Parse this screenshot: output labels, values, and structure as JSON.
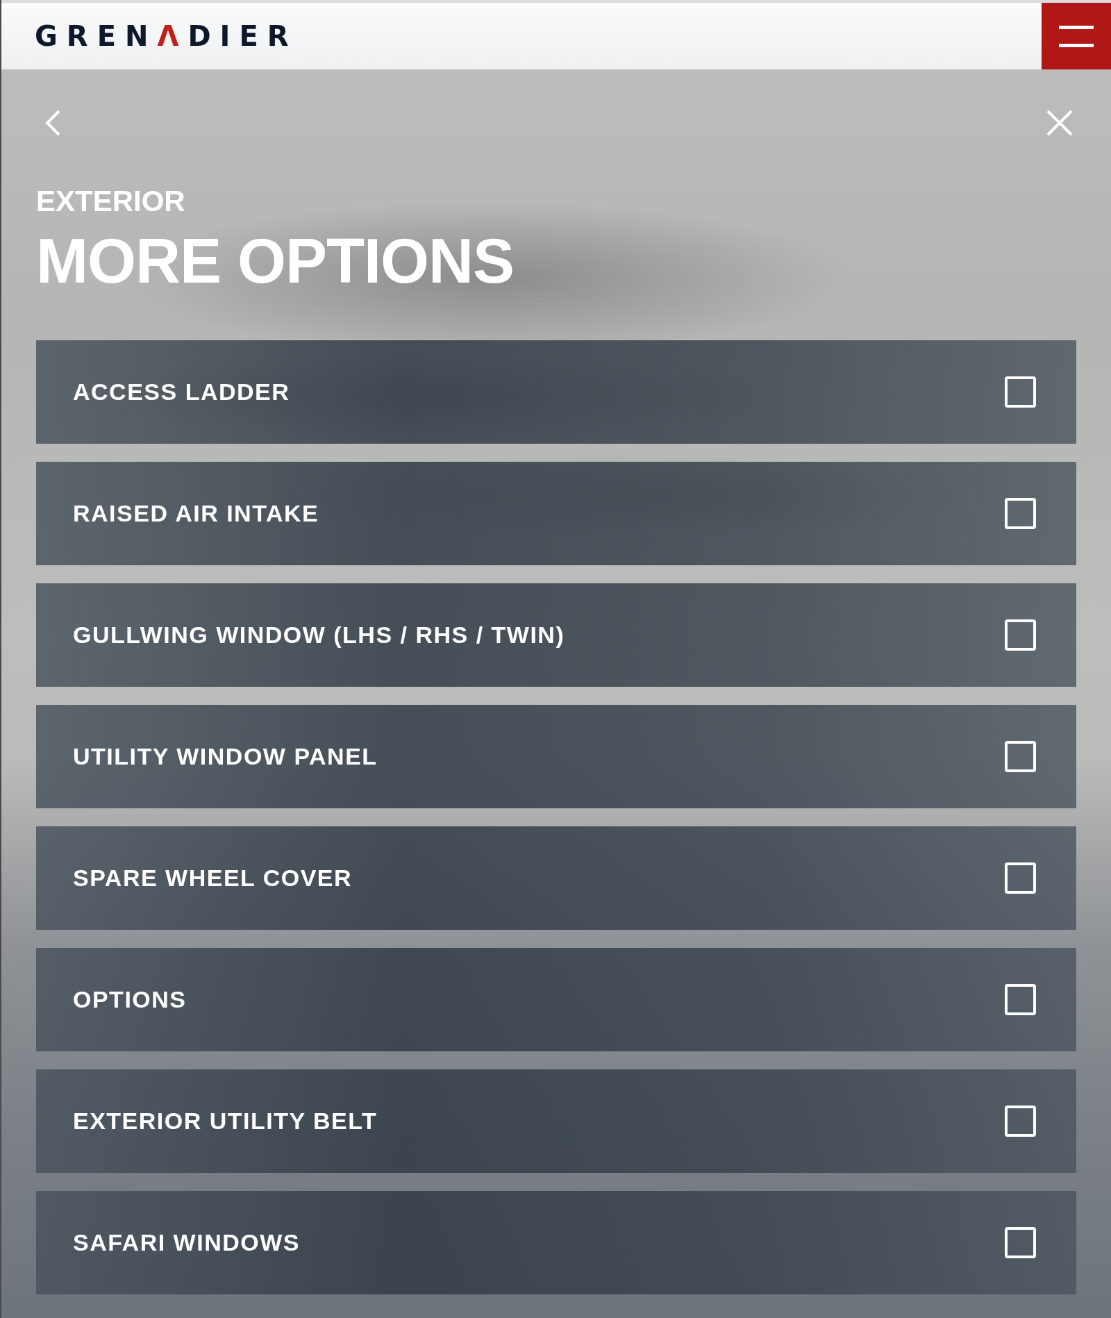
{
  "header": {
    "logo": [
      {
        "text": "GREN",
        "accent": false
      },
      {
        "text": "Λ",
        "accent": true
      },
      {
        "text": "DIER",
        "accent": false
      }
    ]
  },
  "panel": {
    "eyebrow": "EXTERIOR",
    "title": "MORE OPTIONS"
  },
  "options": [
    {
      "label": "ACCESS LADDER",
      "checked": false
    },
    {
      "label": "RAISED AIR INTAKE",
      "checked": false
    },
    {
      "label": "GULLWING WINDOW (LHS / RHS / TWIN)",
      "checked": false
    },
    {
      "label": "UTILITY WINDOW PANEL",
      "checked": false
    },
    {
      "label": "SPARE WHEEL COVER",
      "checked": false
    },
    {
      "label": "OPTIONS",
      "checked": false
    },
    {
      "label": "EXTERIOR UTILITY BELT",
      "checked": false
    },
    {
      "label": "SAFARI WINDOWS",
      "checked": false
    }
  ]
}
